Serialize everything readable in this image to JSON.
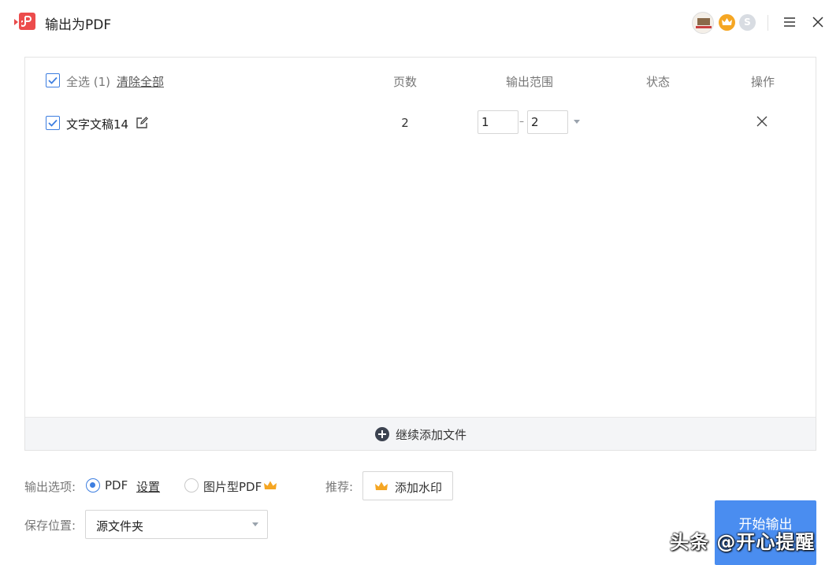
{
  "app": {
    "title": "输出为PDF"
  },
  "titlebar": {
    "s_badge": "S"
  },
  "list": {
    "select_all": "全选 (1)",
    "clear_all": "清除全部",
    "columns": {
      "pages": "页数",
      "range": "输出范围",
      "status": "状态",
      "action": "操作"
    },
    "rows": [
      {
        "name": "文字文稿14",
        "pages": "2",
        "range_from": "1",
        "range_to": "2",
        "range_sep": "–",
        "status": ""
      }
    ],
    "add_more": "继续添加文件"
  },
  "options": {
    "label": "输出选项:",
    "pdf": "PDF",
    "settings": "设置",
    "image_pdf": "图片型PDF",
    "selected": "PDF",
    "recommend": "推荐:",
    "add_watermark": "添加水印"
  },
  "save": {
    "label": "保存位置:",
    "value": "源文件夹"
  },
  "start_button": "开始输出",
  "watermark_text": "头条 @开心提醒",
  "colors": {
    "accent": "#4a8df0",
    "brand_red": "#ec4c4c",
    "crown": "#f5a623"
  },
  "icons": [
    "pdf-logo-icon",
    "vip-crown-icon",
    "menu-icon",
    "close-icon",
    "edit-icon",
    "delete-icon",
    "add-circle-icon",
    "dropdown-arrow-icon"
  ]
}
